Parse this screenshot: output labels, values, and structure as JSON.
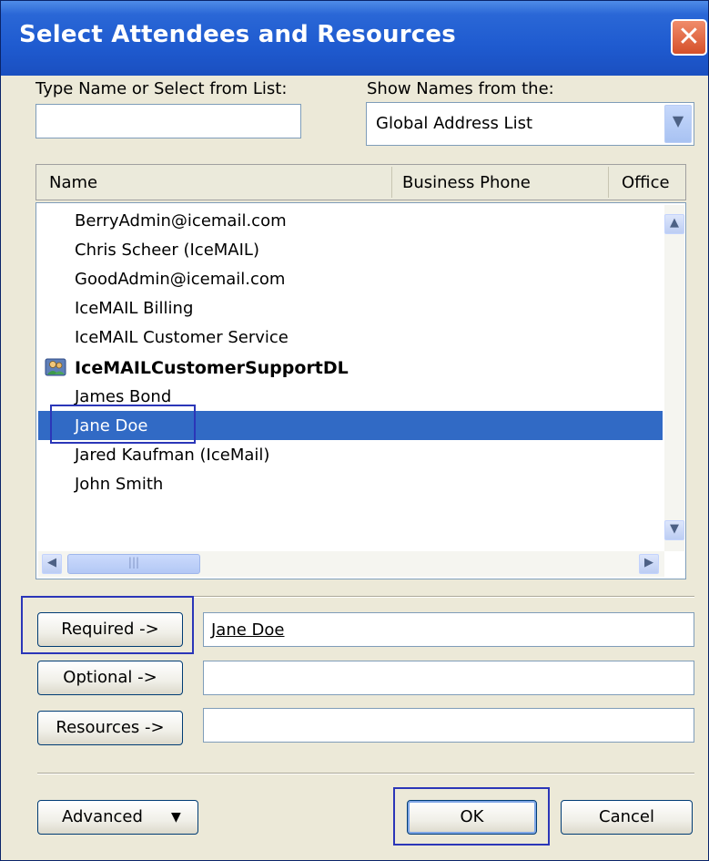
{
  "window": {
    "title": "Select Attendees and Resources",
    "close_symbol": "✕"
  },
  "search": {
    "label": "Type Name or Select from List:",
    "value": ""
  },
  "address_book": {
    "label": "Show Names from the:",
    "selected": "Global Address List",
    "arrow": "▼"
  },
  "columns": [
    "Name",
    "Business Phone",
    "Office"
  ],
  "list": {
    "items": [
      {
        "name": "BerryAdmin@icemail.com"
      },
      {
        "name": "Chris Scheer (IceMAIL)"
      },
      {
        "name": "GoodAdmin@icemail.com"
      },
      {
        "name": "IceMAIL Billing"
      },
      {
        "name": "IceMAIL Customer Service"
      },
      {
        "name": "IceMAILCustomerSupportDL",
        "icon": "distribution-list-icon",
        "bold": true
      },
      {
        "name": "James Bond"
      },
      {
        "name": "Jane Doe",
        "selected": true
      },
      {
        "name": "Jared Kaufman (IceMail)"
      },
      {
        "name": "John Smith"
      }
    ],
    "scroll_up": "▲",
    "scroll_down": "▼",
    "scroll_left": "◀",
    "scroll_right": "▶",
    "thumb_grip": "|||"
  },
  "fields": {
    "required": {
      "button": "Required ->",
      "value": "Jane Doe"
    },
    "optional": {
      "button": "Optional ->",
      "value": ""
    },
    "resources": {
      "button": "Resources ->",
      "value": ""
    }
  },
  "footer": {
    "advanced": "Advanced",
    "advanced_arrow": "▼",
    "ok": "OK",
    "cancel": "Cancel"
  },
  "colors": {
    "titlebar": "#2a67d6",
    "selection": "#316ac5",
    "dialog": "#ece9d8",
    "highlight_box": "#2b36b8"
  }
}
